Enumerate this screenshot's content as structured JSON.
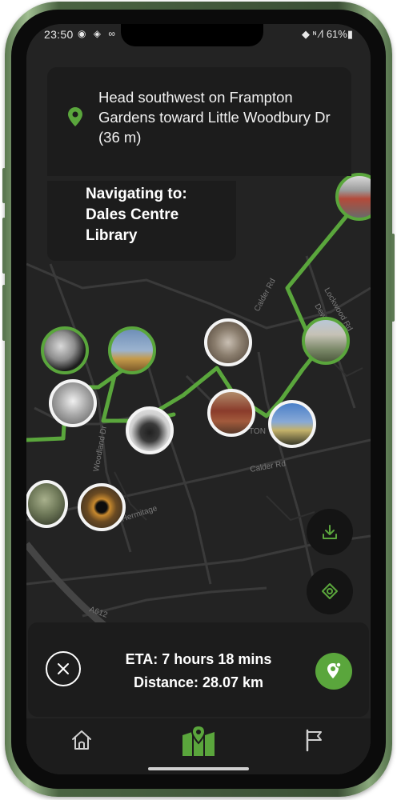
{
  "status_bar": {
    "time": "23:50",
    "left_icons": "◉ ◈ ∞",
    "right_text": "◆ ᶰ ⁄l 61%▮"
  },
  "direction": {
    "instruction": "Head southwest on Frampton Gardens toward Little Woodbury Dr (36 m)"
  },
  "navigation": {
    "label": "Navigating to:",
    "destination": "Dales Centre Library"
  },
  "summary": {
    "eta": "ETA: 7 hours 18 mins",
    "distance": "Distance: 28.07 km"
  },
  "map_labels": {
    "street_1": "Dewsbury Rd",
    "street_2": "Lockwood Rd",
    "street_3": "Calder Rd",
    "street_4": "Hermitage",
    "street_5": "Calder Rd",
    "street_6": "A612",
    "street_7": "TON",
    "street_8": "Woodland Dr"
  },
  "colors": {
    "accent": "#5aa63c",
    "panel": "#1c1c1c",
    "map_bg": "#232323",
    "road": "#3a3a3a"
  },
  "icons": {
    "pin": "map-pin-icon",
    "download": "download-icon",
    "locate": "locate-icon",
    "cancel": "close-icon",
    "route": "route-pin-icon",
    "home": "home-icon",
    "map": "map-icon",
    "flag": "flag-icon"
  }
}
